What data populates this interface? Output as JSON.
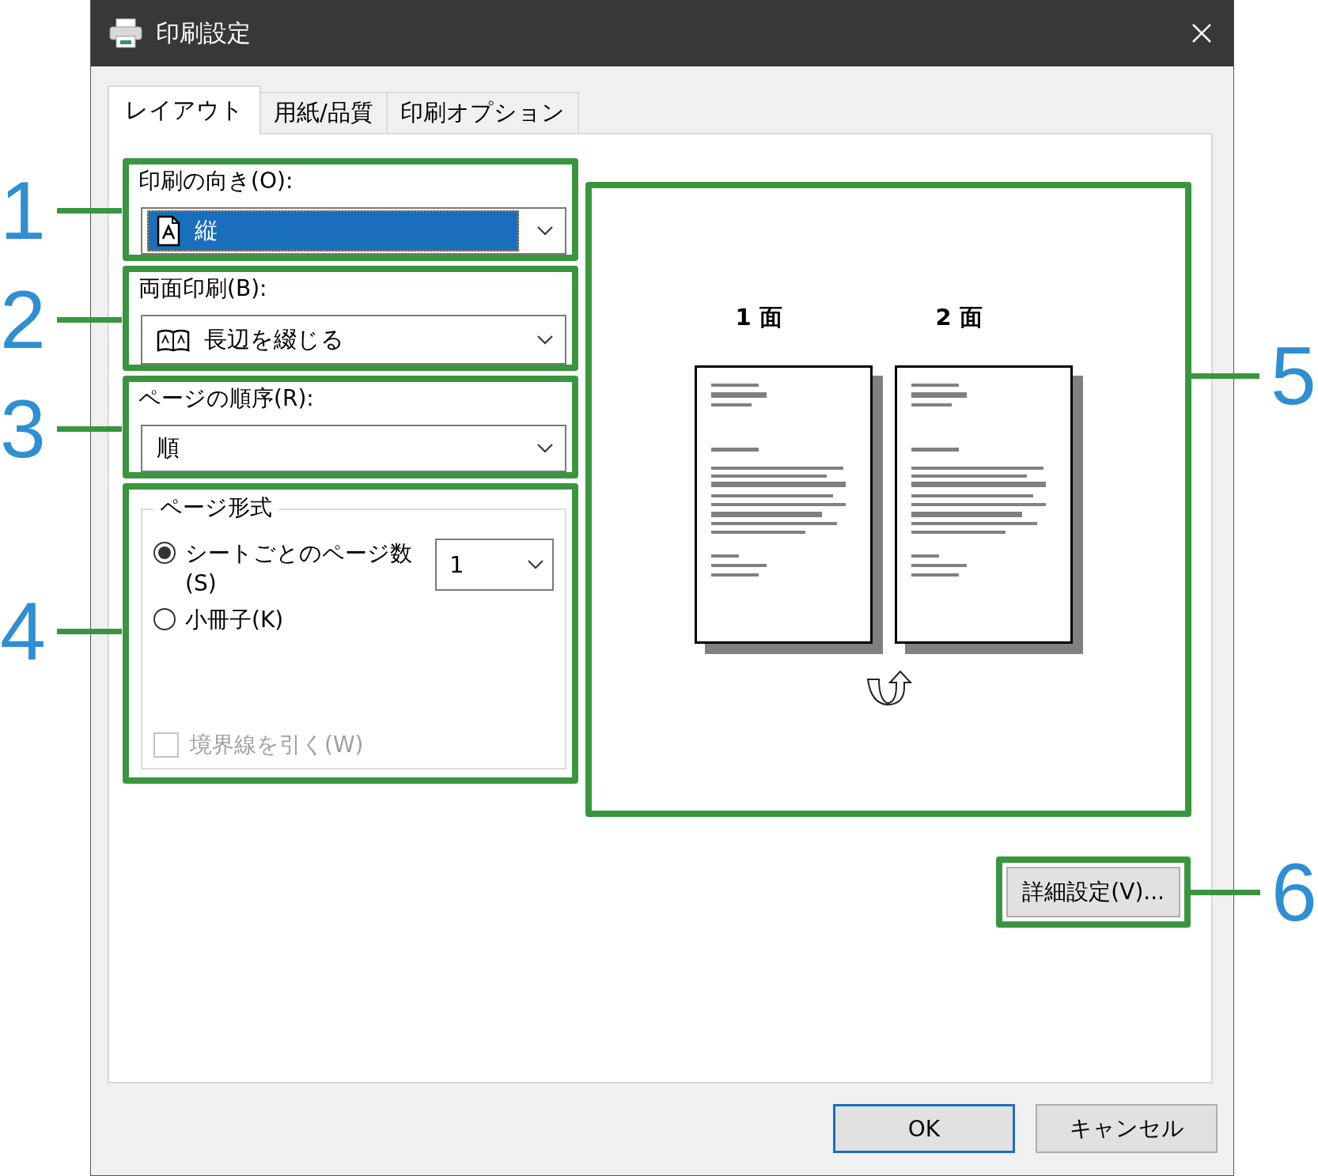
{
  "window": {
    "title": "印刷設定"
  },
  "tabs": [
    {
      "label": "レイアウト",
      "selected": true
    },
    {
      "label": "用紙/品質",
      "selected": false
    },
    {
      "label": "印刷オプション",
      "selected": false
    }
  ],
  "orientation": {
    "label": "印刷の向き(O):",
    "value": "縦",
    "focused": true
  },
  "duplex": {
    "label": "両面印刷(B):",
    "value": "長辺を綴じる"
  },
  "page_order": {
    "label": "ページの順序(R):",
    "value": "順"
  },
  "page_format": {
    "legend": "ページ形式",
    "options": [
      {
        "label": "シートごとのページ数(S)",
        "selected": true
      },
      {
        "label": "小冊子(K)",
        "selected": false
      }
    ],
    "pages_per_sheet": "1",
    "draw_borders": {
      "label": "境界線を引く(W)",
      "checked": false,
      "disabled": true
    }
  },
  "preview": {
    "page_labels": [
      "1 面",
      "2 面"
    ]
  },
  "advanced_button": "詳細設定(V)...",
  "buttons": [
    {
      "label": "OK",
      "default": true
    },
    {
      "label": "キャンセル",
      "default": false
    }
  ],
  "callouts": [
    "1",
    "2",
    "3",
    "4",
    "5",
    "6"
  ]
}
